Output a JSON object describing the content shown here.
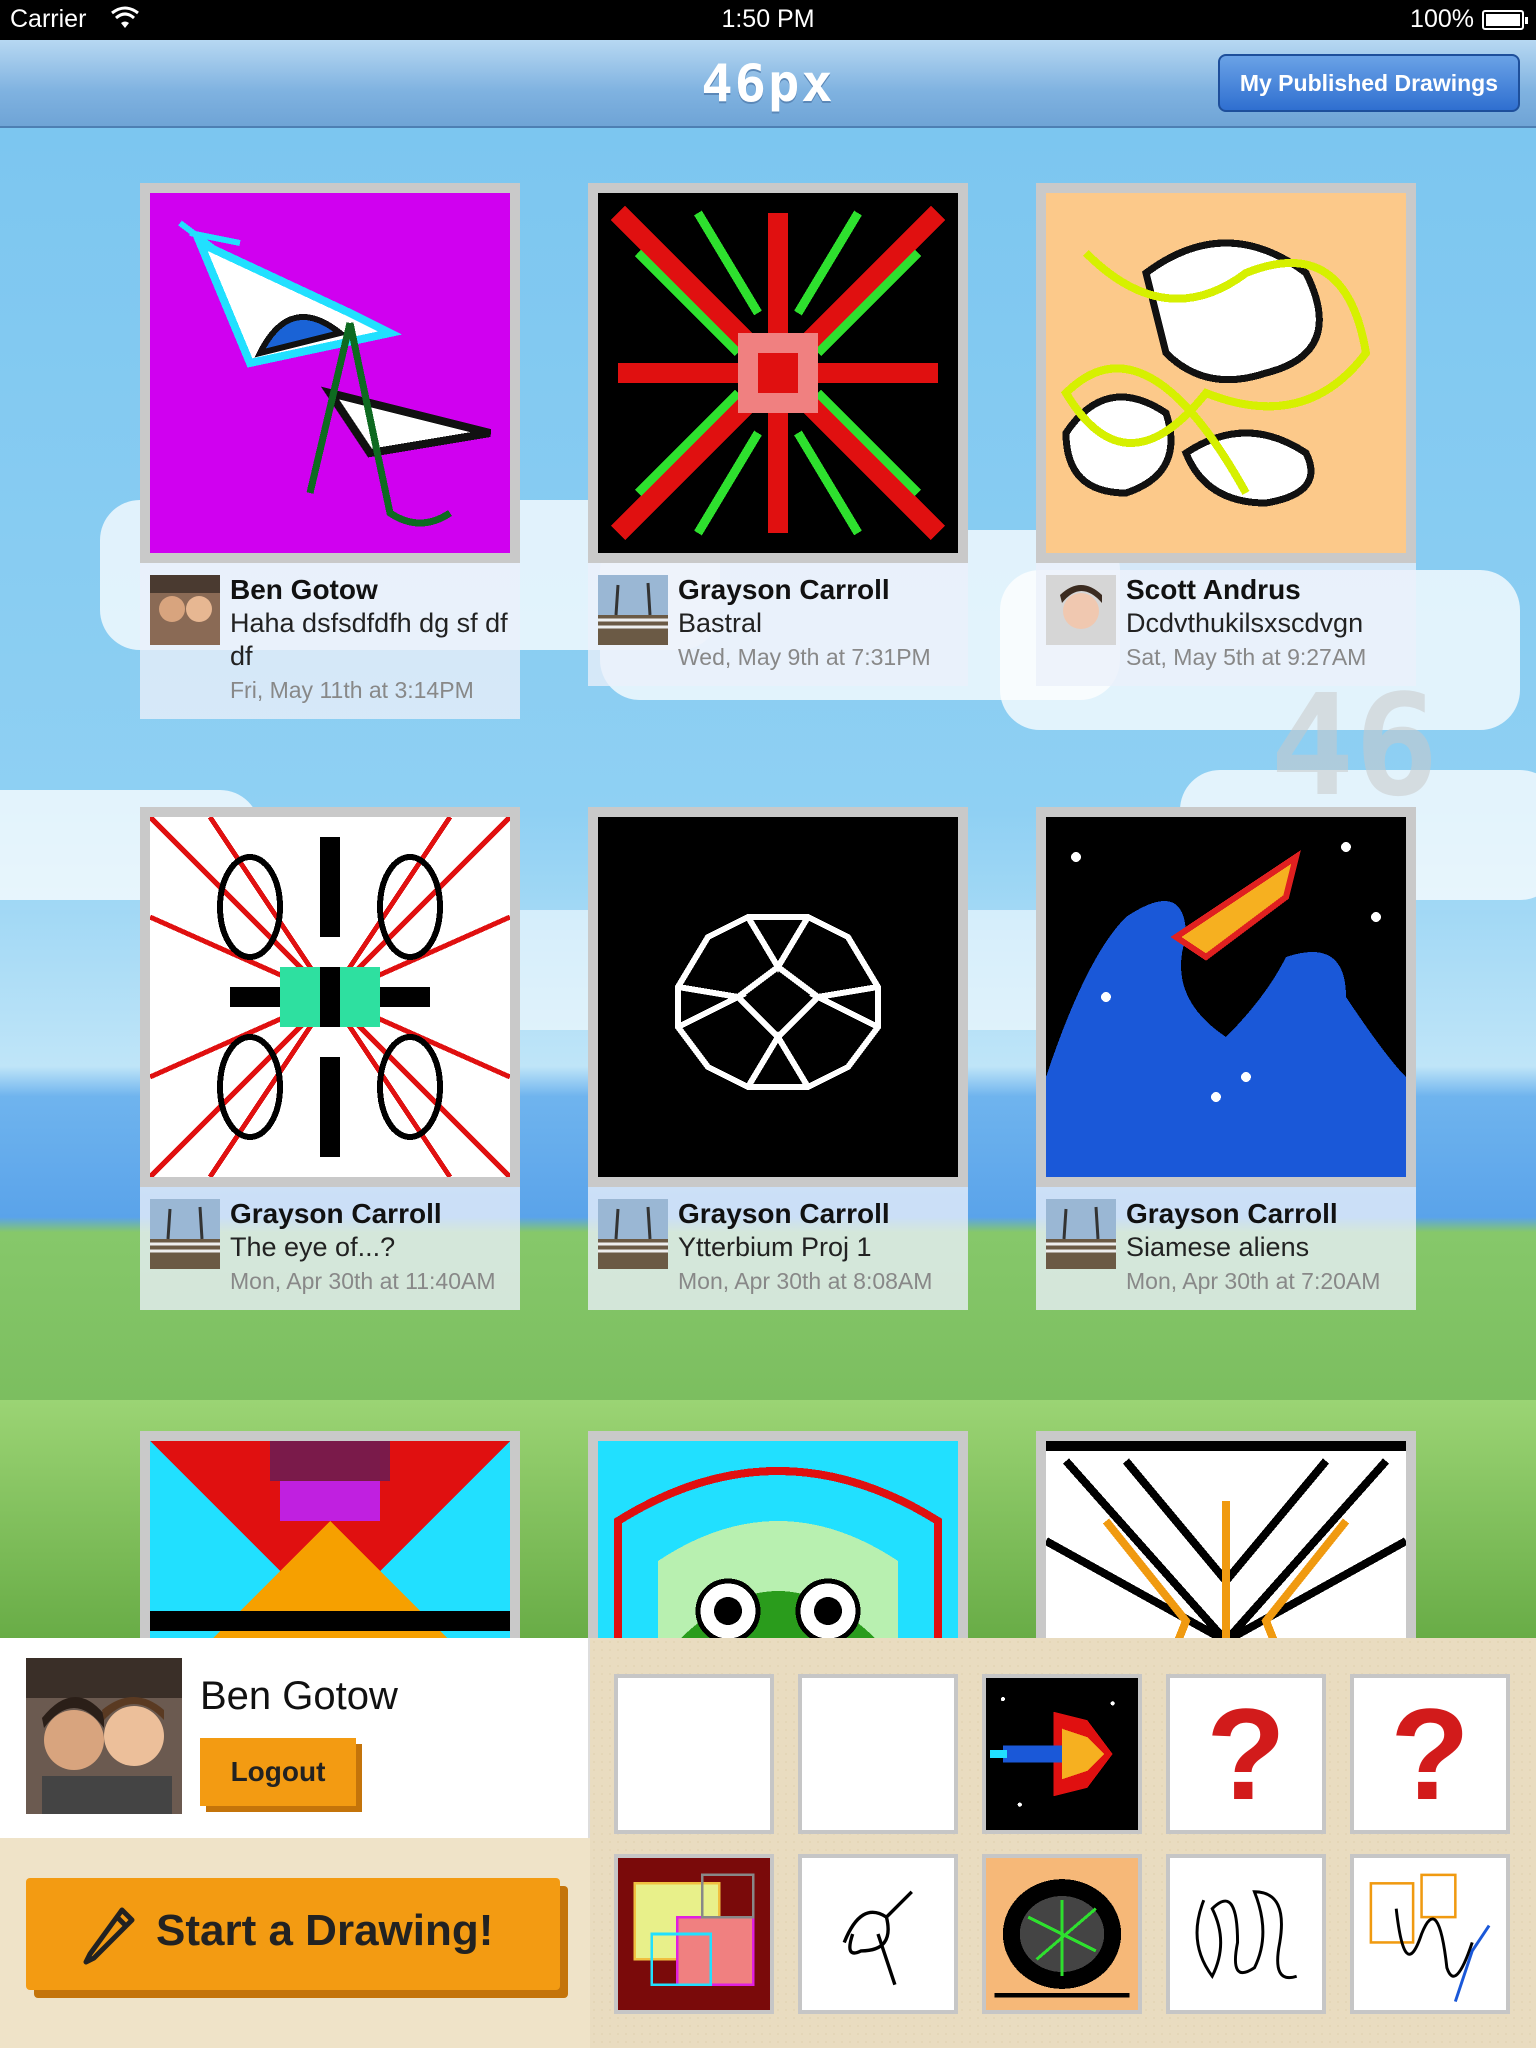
{
  "status_bar": {
    "carrier": "Carrier",
    "time": "1:50 PM",
    "battery": "100%"
  },
  "nav": {
    "logo": "46px",
    "published_button": "My Published Drawings"
  },
  "background_watermark": "46",
  "feed": [
    {
      "author": "Ben Gotow",
      "title": "Haha dsfsdfdfh dg sf df df",
      "date": "Fri, May 11th at 3:14PM"
    },
    {
      "author": "Grayson Carroll",
      "title": "Bastral",
      "date": "Wed, May 9th at 7:31PM"
    },
    {
      "author": "Scott Andrus",
      "title": "Dcdvthukilsxscdvgn",
      "date": "Sat, May 5th at 9:27AM"
    },
    {
      "author": "Grayson Carroll",
      "title": "The eye of...?",
      "date": "Mon, Apr 30th at 11:40AM"
    },
    {
      "author": "Grayson Carroll",
      "title": "Ytterbium Proj 1",
      "date": "Mon, Apr 30th at 8:08AM"
    },
    {
      "author": "Grayson Carroll",
      "title": "Siamese aliens",
      "date": "Mon, Apr 30th at 7:20AM"
    }
  ],
  "profile": {
    "name": "Ben Gotow",
    "logout": "Logout"
  },
  "start_drawing": "Start a Drawing!",
  "my_drawings": [
    {
      "kind": "blank"
    },
    {
      "kind": "blank"
    },
    {
      "kind": "spaceship"
    },
    {
      "kind": "unknown",
      "mark": "?"
    },
    {
      "kind": "unknown",
      "mark": "?"
    },
    {
      "kind": "squares"
    },
    {
      "kind": "scribble"
    },
    {
      "kind": "frog"
    },
    {
      "kind": "scribble"
    },
    {
      "kind": "boxes"
    }
  ],
  "colors": {
    "accent_orange": "#f39b12",
    "nav_blue": "#2f6fd0",
    "date_gray": "#888888"
  }
}
